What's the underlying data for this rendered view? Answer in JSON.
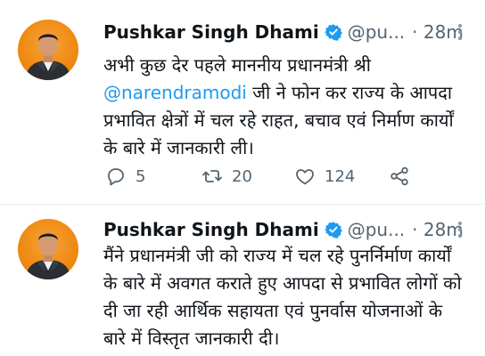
{
  "tweets": [
    {
      "author": {
        "name": "Pushkar Singh Dhami",
        "handle": "@pu...",
        "time": "· 28m",
        "avatar": "profile-photo"
      },
      "text_before": "अभी कुछ देर पहले माननीय प्रधानमंत्री श्री ",
      "mention": "@narendramodi",
      "text_after": " जी ने फोन कर राज्य के आपदा प्रभावित क्षेत्रों में चल रहे राहत, बचाव एवं निर्माण कार्यों के बारे में जानकारी ली।",
      "actions": {
        "reply_count": "5",
        "retweet_count": "20",
        "like_count": "124"
      }
    },
    {
      "author": {
        "name": "Pushkar Singh Dhami",
        "handle": "@pu...",
        "time": "· 28m",
        "avatar": "profile-photo"
      },
      "text": "मैंने प्रधानमंत्री जी को राज्य में चल रहे पुनर्निर्माण कार्यों के बारे में अवगत कराते हुए आपदा से प्रभावित लोगों को दी जा रही आर्थिक सहायता एवं पुनर्वास योजनाओं के बारे में विस्तृत जानकारी दी।"
    }
  ],
  "icons": [
    "verified-badge-icon",
    "more-options-icon",
    "reply-icon",
    "retweet-icon",
    "like-icon",
    "share-icon"
  ],
  "colors": {
    "link": "#1d9bf0",
    "secondary_text": "#536471",
    "avatar_background": "#f08b14"
  }
}
